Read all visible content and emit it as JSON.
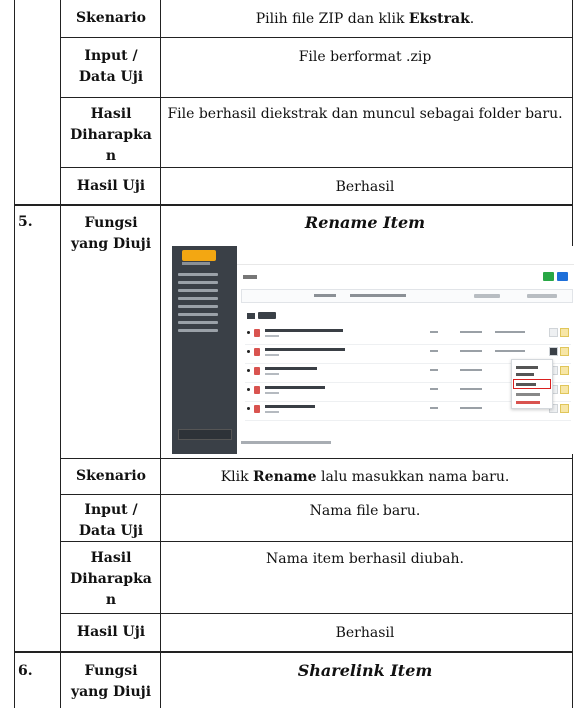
{
  "rows": {
    "skenario1": {
      "label": "Skenario",
      "value_pre": "Pilih file ZIP dan klik ",
      "value_bold": "Ekstrak",
      "value_post": "."
    },
    "input1": {
      "label_line1": "Input /",
      "label_line2": "Data Uji",
      "value": "File berformat .zip"
    },
    "hasil1": {
      "label_line1": "Hasil",
      "label_line2": "Diharapka",
      "label_line3": "n",
      "value": "File berhasil diekstrak dan muncul sebagai folder baru."
    },
    "uji1": {
      "label": "Hasil Uji",
      "value": "Berhasil"
    },
    "fungsi5": {
      "number": "5.",
      "label_line1": "Fungsi",
      "label_line2": "yang Diuji",
      "title": "Rename Item"
    },
    "skenario2": {
      "label": "Skenario",
      "value_pre": "Klik ",
      "value_bold": "Rename",
      "value_post": " lalu masukkan nama baru."
    },
    "input2": {
      "label_line1": "Input /",
      "label_line2": "Data Uji",
      "value": "Nama file baru."
    },
    "hasil2": {
      "label_line1": "Hasil",
      "label_line2": "Diharapka",
      "label_line3": "n",
      "value": "Nama item berhasil diubah."
    },
    "uji2": {
      "label": "Hasil Uji",
      "value": "Berhasil"
    },
    "fungsi6": {
      "number": "6.",
      "label_line1": "Fungsi",
      "label_line2": "yang Diuji",
      "title": "Sharelink Item"
    }
  },
  "screenshot": {
    "colors": {
      "sidebar": "#3a4047",
      "logo": "#f3a712",
      "green_button": "#28a745",
      "blue_button": "#1e6fd9",
      "highlight": "#d9201f",
      "file_icon": "#d9534f"
    },
    "icons": [
      "folder-icon",
      "pdf-file-icon",
      "more-options-icon"
    ]
  }
}
